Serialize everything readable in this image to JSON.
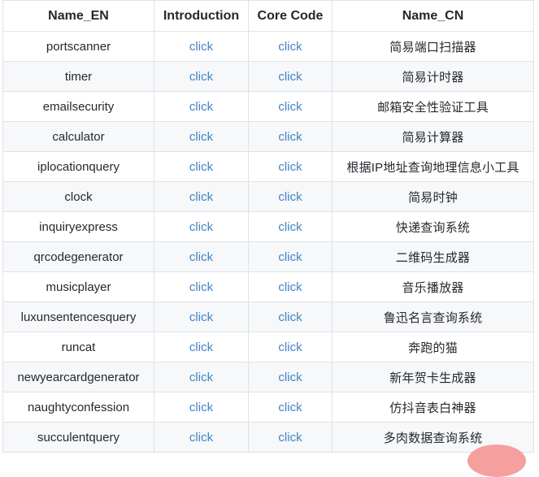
{
  "table": {
    "columns": [
      {
        "key": "name_en",
        "label": "Name_EN"
      },
      {
        "key": "introduction",
        "label": "Introduction"
      },
      {
        "key": "core_code",
        "label": "Core Code"
      },
      {
        "key": "name_cn",
        "label": "Name_CN"
      }
    ],
    "link_label": "click",
    "link_color": "#4183c4",
    "header_color": "#24292e",
    "border_color": "#dfe2e5",
    "alt_row_color": "#f6f8fa",
    "rows": [
      {
        "name_en": "portscanner",
        "introduction": "click",
        "core_code": "click",
        "name_cn": "简易端口扫描器"
      },
      {
        "name_en": "timer",
        "introduction": "click",
        "core_code": "click",
        "name_cn": "简易计时器"
      },
      {
        "name_en": "emailsecurity",
        "introduction": "click",
        "core_code": "click",
        "name_cn": "邮箱安全性验证工具"
      },
      {
        "name_en": "calculator",
        "introduction": "click",
        "core_code": "click",
        "name_cn": "简易计算器"
      },
      {
        "name_en": "iplocationquery",
        "introduction": "click",
        "core_code": "click",
        "name_cn": "根据IP地址查询地理信息小工具"
      },
      {
        "name_en": "clock",
        "introduction": "click",
        "core_code": "click",
        "name_cn": "简易时钟"
      },
      {
        "name_en": "inquiryexpress",
        "introduction": "click",
        "core_code": "click",
        "name_cn": "快递查询系统"
      },
      {
        "name_en": "qrcodegenerator",
        "introduction": "click",
        "core_code": "click",
        "name_cn": "二维码生成器"
      },
      {
        "name_en": "musicplayer",
        "introduction": "click",
        "core_code": "click",
        "name_cn": "音乐播放器"
      },
      {
        "name_en": "luxunsentencesquery",
        "introduction": "click",
        "core_code": "click",
        "name_cn": "鲁迅名言查询系统"
      },
      {
        "name_en": "runcat",
        "introduction": "click",
        "core_code": "click",
        "name_cn": "奔跑的猫"
      },
      {
        "name_en": "newyearcardgenerator",
        "introduction": "click",
        "core_code": "click",
        "name_cn": "新年贺卡生成器"
      },
      {
        "name_en": "naughtyconfession",
        "introduction": "click",
        "core_code": "click",
        "name_cn": "仿抖音表白神器"
      },
      {
        "name_en": "succulentquery",
        "introduction": "click",
        "core_code": "click",
        "name_cn": "多肉数据查询系统"
      }
    ]
  },
  "decoration": {
    "blob_color": "#f59a9a"
  }
}
